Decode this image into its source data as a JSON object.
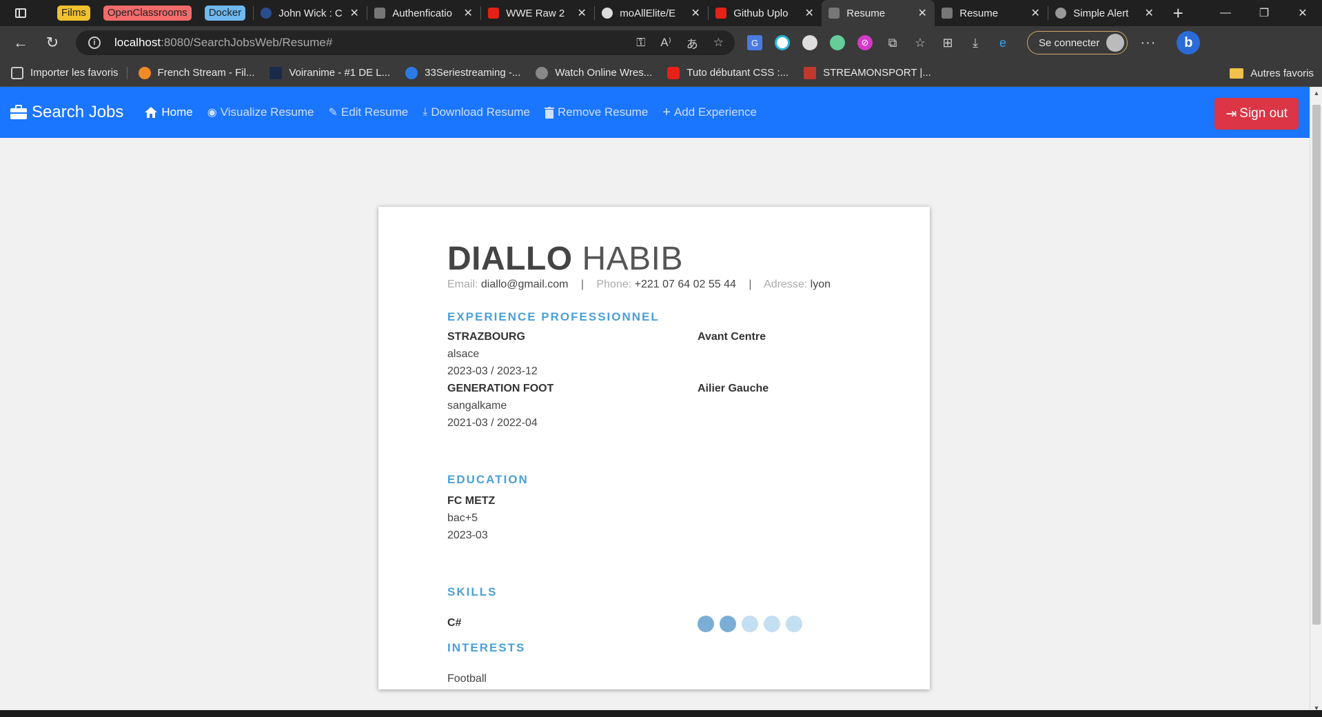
{
  "browser": {
    "tab_groups": [
      {
        "label": "Films",
        "bg": "#f2c12e",
        "fg": "#222"
      },
      {
        "label": "OpenClassrooms",
        "bg": "#f36b6b",
        "fg": "#222"
      },
      {
        "label": "Docker",
        "bg": "#6fb8f0",
        "fg": "#222"
      }
    ],
    "tabs": [
      {
        "label": "John Wick : C",
        "favicon": "#2a4d8f"
      },
      {
        "label": "Authenficatio",
        "favicon": "#777"
      },
      {
        "label": "WWE Raw 2",
        "favicon": "#e62117"
      },
      {
        "label": "moAllElite/E",
        "favicon": "#ddd"
      },
      {
        "label": "Github Uplo",
        "favicon": "#e62117"
      },
      {
        "label": "Resume",
        "favicon": "#777",
        "active": true
      },
      {
        "label": "Resume",
        "favicon": "#777"
      },
      {
        "label": "Simple Alert",
        "favicon": "#999"
      }
    ],
    "url_host": "localhost",
    "url_path": ":8080/SearchJobsWeb/Resume#",
    "signin_label": "Se connecter",
    "favorites": [
      {
        "label": "Importer les favoris",
        "color": "transparent"
      },
      {
        "label": "French Stream - Fil...",
        "color": "#f08a24"
      },
      {
        "label": "Voiranime - #1 DE L...",
        "color": "#1b2a4a"
      },
      {
        "label": "33Seriestreaming -...",
        "color": "#2c7be5"
      },
      {
        "label": "Watch Online Wres...",
        "color": "#888"
      },
      {
        "label": "Tuto débutant CSS :...",
        "color": "#e62117"
      },
      {
        "label": "STREAMONSPORT |...",
        "color": "#c0392b"
      }
    ],
    "other_favorites": "Autres favoris"
  },
  "app": {
    "brand": "Search Jobs",
    "nav": [
      "Home",
      "Visualize Resume",
      "Edit Resume",
      "Download Resume",
      "Remove Resume",
      "Add Experience"
    ],
    "signout": "Sign out"
  },
  "resume": {
    "first_name": "DIALLO",
    "last_name": "HABIB",
    "email_label": "Email:",
    "email": "diallo@gmail.com",
    "phone_label": "Phone:",
    "phone": "+221 07 64 02 55 44",
    "address_label": "Adresse:",
    "address": "lyon",
    "separator": "|",
    "sections": {
      "experience": "EXPERIENCE PROFESSIONNEL",
      "education": "EDUCATION",
      "skills": "SKILLS",
      "interests": "INTERESTS"
    },
    "experience": [
      {
        "company": "STRAZBOURG",
        "location": "alsace",
        "dates": "2023-03 / 2023-12",
        "role": "Avant Centre"
      },
      {
        "company": "GENERATION FOOT",
        "location": "sangalkame",
        "dates": "2021-03 / 2022-04",
        "role": "Ailier Gauche"
      }
    ],
    "education": [
      {
        "school": "FC METZ",
        "degree": "bac+5",
        "date": "2023-03"
      }
    ],
    "skills": [
      {
        "name": "C#",
        "level": 2,
        "max": 5
      }
    ],
    "interests": [
      "Football"
    ],
    "colors": {
      "accent": "#4aa0d6",
      "dot_filled": "#7baed6",
      "dot_empty": "#c4def2"
    }
  }
}
